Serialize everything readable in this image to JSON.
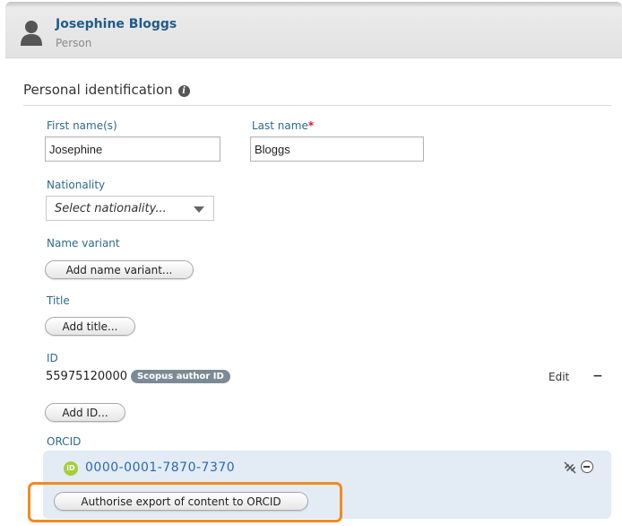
{
  "header": {
    "name": "Josephine Bloggs",
    "type": "Person"
  },
  "section": {
    "title": "Personal identification"
  },
  "fields": {
    "first_name_label": "First name(s)",
    "first_name_value": "Josephine",
    "last_name_label": "Last name",
    "last_name_required": "*",
    "last_name_value": "Bloggs",
    "nationality_label": "Nationality",
    "nationality_value": "Select nationality...",
    "name_variant_label": "Name variant",
    "name_variant_button": "Add name variant...",
    "title_label": "Title",
    "title_button": "Add title...",
    "id_label": "ID",
    "id_value": "55975120000",
    "id_type_badge": "Scopus author ID",
    "id_edit": "Edit",
    "id_remove": "−",
    "add_id_button": "Add ID...",
    "orcid_label": "ORCID",
    "orcid_value": "0000-0001-7870-7370",
    "orcid_logo_text": "iD",
    "orcid_authorise_button": "Authorise export of content to ORCID"
  },
  "icons": {
    "avatar": "person-silhouette-icon",
    "info": "info-icon",
    "unlink": "unlink-icon",
    "remove": "remove-circle-icon"
  },
  "colors": {
    "name_link": "#1f5c8a",
    "label": "#2d6a8f",
    "orcid_green": "#a6ce39",
    "orcid_link": "#2a6ab0",
    "highlight": "#f28a1e",
    "badge": "#7d8a96"
  }
}
